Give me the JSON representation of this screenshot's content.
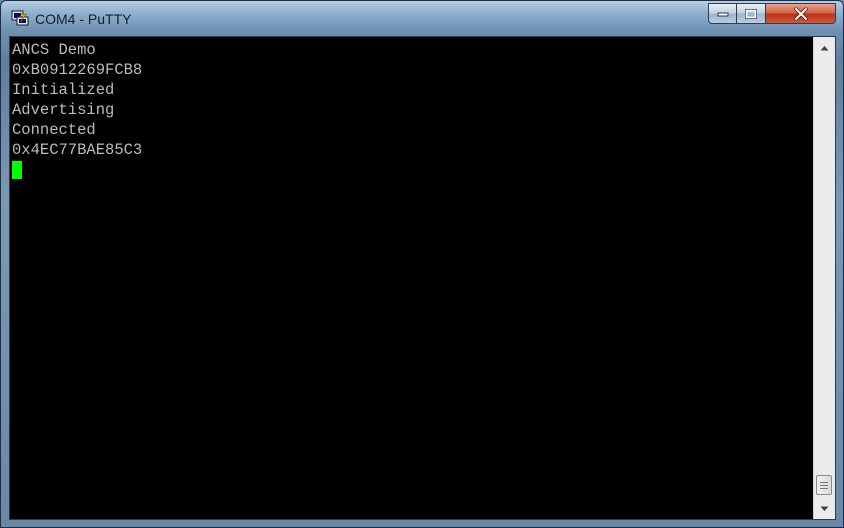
{
  "window": {
    "title": "COM4 - PuTTY",
    "title_icon": "putty-icon"
  },
  "caption_buttons": {
    "minimize_icon": "minimize-icon",
    "maximize_icon": "maximize-icon",
    "close_icon": "close-icon"
  },
  "terminal": {
    "lines": [
      "ANCS Demo",
      "0xB0912269FCB8",
      "Initialized",
      "Advertising",
      "Connected",
      "0x4EC77BAE85C3"
    ],
    "text_color": "#bbbbbb",
    "background": "#000000",
    "cursor_color": "#00ff00"
  },
  "scrollbar": {
    "up_icon": "arrow-up-icon",
    "down_icon": "arrow-down-icon",
    "position": 1.0
  }
}
